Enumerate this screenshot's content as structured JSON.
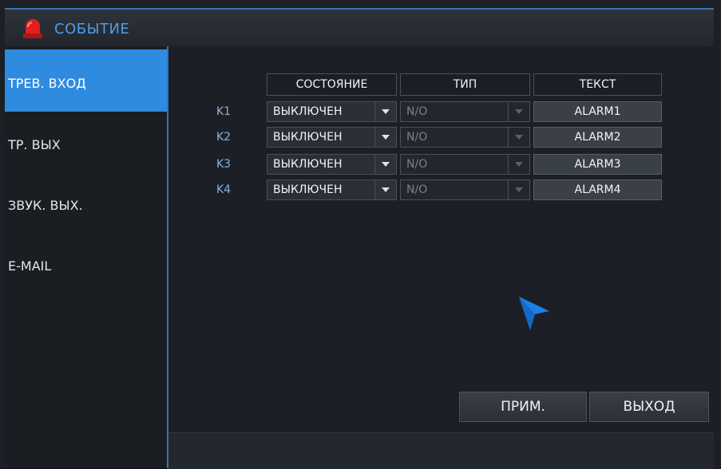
{
  "window": {
    "title": "СОБЫТИЕ"
  },
  "sidebar": {
    "items": [
      {
        "label": "ТРЕВ. ВХОД",
        "active": true
      },
      {
        "label": "ТР. ВЫХ",
        "active": false
      },
      {
        "label": "ЗВУК. ВЫХ.",
        "active": false
      },
      {
        "label": "E-MAIL",
        "active": false
      }
    ]
  },
  "table": {
    "headers": {
      "state": "СОСТОЯНИЕ",
      "type": "ТИП",
      "text": "ТЕКСТ"
    },
    "rows": [
      {
        "label": "K1",
        "state": "ВЫКЛЮЧЕН",
        "type": "N/O",
        "text": "ALARM1"
      },
      {
        "label": "K2",
        "state": "ВЫКЛЮЧЕН",
        "type": "N/O",
        "text": "ALARM2"
      },
      {
        "label": "K3",
        "state": "ВЫКЛЮЧЕН",
        "type": "N/O",
        "text": "ALARM3"
      },
      {
        "label": "K4",
        "state": "ВЫКЛЮЧЕН",
        "type": "N/O",
        "text": "ALARM4"
      }
    ]
  },
  "footer": {
    "apply_label": "ПРИМ.",
    "exit_label": "ВЫХОД"
  },
  "colors": {
    "accent": "#2f8be0",
    "title_text": "#4c9ee8",
    "alarm_icon": "#e01f1f"
  },
  "icons": {
    "title_icon": "alarm-siren-icon",
    "dropdown": "chevron-down-icon",
    "pointer": "mouse-pointer-icon"
  }
}
